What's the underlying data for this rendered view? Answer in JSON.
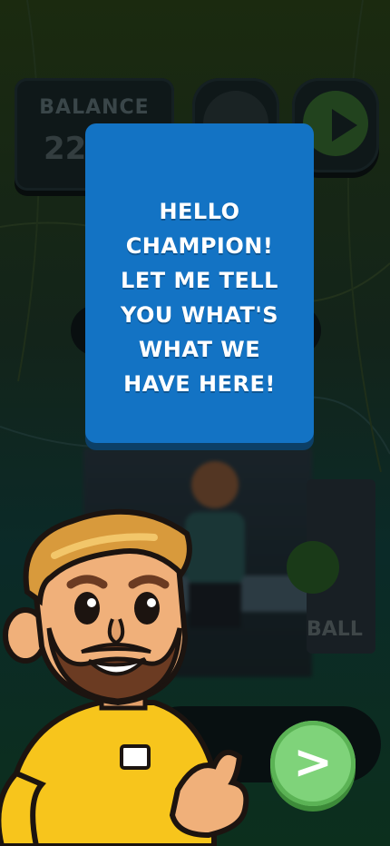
{
  "background_ui": {
    "balance_label": "BALANCE",
    "balance_value": "22",
    "game_label": "BALL"
  },
  "dialog": {
    "message": "HELLO\nCHAMPION!\nLET ME TELL\nYOU WHAT'S\nWHAT WE\nHAVE HERE!"
  },
  "next_button": {
    "label": ">"
  },
  "colors": {
    "dialog_bg": "#1373c4",
    "next_button": "#7fd37a",
    "mascot_shirt": "#f7c51c"
  }
}
